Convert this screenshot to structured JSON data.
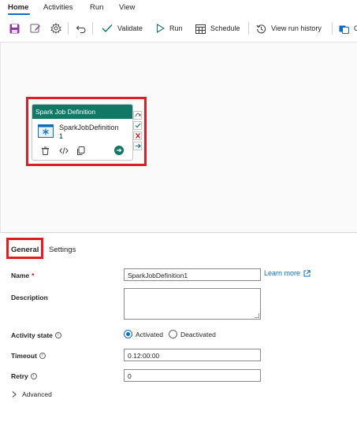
{
  "menu": {
    "tabs": [
      "Home",
      "Activities",
      "Run",
      "View"
    ]
  },
  "toolbar": {
    "validate_label": "Validate",
    "run_label": "Run",
    "schedule_label": "Schedule",
    "history_label": "View run history",
    "truncated_label": "C",
    "icons": [
      "save-icon",
      "edit-icon",
      "gear-icon",
      "undo-icon",
      "check-icon",
      "play-icon",
      "calendar-icon",
      "history-icon",
      "copy-icon"
    ]
  },
  "canvas": {
    "activity": {
      "header": "Spark Job Definition",
      "name_line1": "SparkJobDefinition",
      "name_line2": "1"
    }
  },
  "tabs": {
    "general": "General",
    "settings": "Settings"
  },
  "form": {
    "name_label": "Name",
    "name_required": "*",
    "name_value": "SparkJobDefinition1",
    "learn_more": "Learn more",
    "description_label": "Description",
    "description_value": "",
    "activity_state_label": "Activity state",
    "state_activated": "Activated",
    "state_deactivated": "Deactivated",
    "state_selected": "Activated",
    "timeout_label": "Timeout",
    "timeout_value": "0.12:00:00",
    "retry_label": "Retry",
    "retry_value": "0",
    "advanced_label": "Advanced"
  },
  "colors": {
    "accent": "#0f6cbd",
    "activity_header": "#117865",
    "highlight": "#e01e22"
  }
}
